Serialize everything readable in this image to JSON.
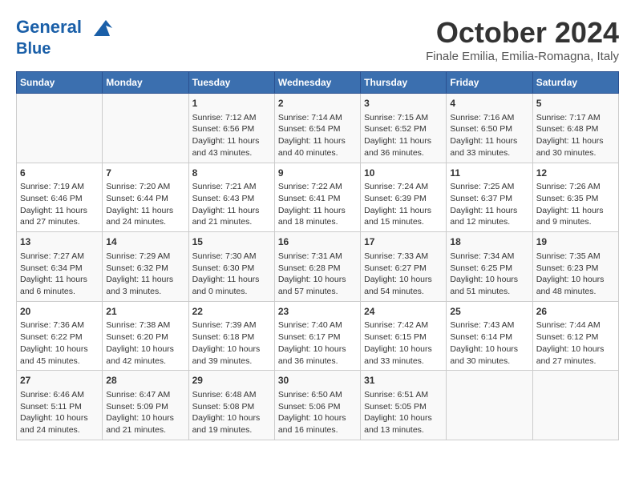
{
  "header": {
    "logo_line1": "General",
    "logo_line2": "Blue",
    "month": "October 2024",
    "location": "Finale Emilia, Emilia-Romagna, Italy"
  },
  "weekdays": [
    "Sunday",
    "Monday",
    "Tuesday",
    "Wednesday",
    "Thursday",
    "Friday",
    "Saturday"
  ],
  "weeks": [
    [
      {
        "day": "",
        "data": ""
      },
      {
        "day": "",
        "data": ""
      },
      {
        "day": "1",
        "data": "Sunrise: 7:12 AM\nSunset: 6:56 PM\nDaylight: 11 hours and 43 minutes."
      },
      {
        "day": "2",
        "data": "Sunrise: 7:14 AM\nSunset: 6:54 PM\nDaylight: 11 hours and 40 minutes."
      },
      {
        "day": "3",
        "data": "Sunrise: 7:15 AM\nSunset: 6:52 PM\nDaylight: 11 hours and 36 minutes."
      },
      {
        "day": "4",
        "data": "Sunrise: 7:16 AM\nSunset: 6:50 PM\nDaylight: 11 hours and 33 minutes."
      },
      {
        "day": "5",
        "data": "Sunrise: 7:17 AM\nSunset: 6:48 PM\nDaylight: 11 hours and 30 minutes."
      }
    ],
    [
      {
        "day": "6",
        "data": "Sunrise: 7:19 AM\nSunset: 6:46 PM\nDaylight: 11 hours and 27 minutes."
      },
      {
        "day": "7",
        "data": "Sunrise: 7:20 AM\nSunset: 6:44 PM\nDaylight: 11 hours and 24 minutes."
      },
      {
        "day": "8",
        "data": "Sunrise: 7:21 AM\nSunset: 6:43 PM\nDaylight: 11 hours and 21 minutes."
      },
      {
        "day": "9",
        "data": "Sunrise: 7:22 AM\nSunset: 6:41 PM\nDaylight: 11 hours and 18 minutes."
      },
      {
        "day": "10",
        "data": "Sunrise: 7:24 AM\nSunset: 6:39 PM\nDaylight: 11 hours and 15 minutes."
      },
      {
        "day": "11",
        "data": "Sunrise: 7:25 AM\nSunset: 6:37 PM\nDaylight: 11 hours and 12 minutes."
      },
      {
        "day": "12",
        "data": "Sunrise: 7:26 AM\nSunset: 6:35 PM\nDaylight: 11 hours and 9 minutes."
      }
    ],
    [
      {
        "day": "13",
        "data": "Sunrise: 7:27 AM\nSunset: 6:34 PM\nDaylight: 11 hours and 6 minutes."
      },
      {
        "day": "14",
        "data": "Sunrise: 7:29 AM\nSunset: 6:32 PM\nDaylight: 11 hours and 3 minutes."
      },
      {
        "day": "15",
        "data": "Sunrise: 7:30 AM\nSunset: 6:30 PM\nDaylight: 11 hours and 0 minutes."
      },
      {
        "day": "16",
        "data": "Sunrise: 7:31 AM\nSunset: 6:28 PM\nDaylight: 10 hours and 57 minutes."
      },
      {
        "day": "17",
        "data": "Sunrise: 7:33 AM\nSunset: 6:27 PM\nDaylight: 10 hours and 54 minutes."
      },
      {
        "day": "18",
        "data": "Sunrise: 7:34 AM\nSunset: 6:25 PM\nDaylight: 10 hours and 51 minutes."
      },
      {
        "day": "19",
        "data": "Sunrise: 7:35 AM\nSunset: 6:23 PM\nDaylight: 10 hours and 48 minutes."
      }
    ],
    [
      {
        "day": "20",
        "data": "Sunrise: 7:36 AM\nSunset: 6:22 PM\nDaylight: 10 hours and 45 minutes."
      },
      {
        "day": "21",
        "data": "Sunrise: 7:38 AM\nSunset: 6:20 PM\nDaylight: 10 hours and 42 minutes."
      },
      {
        "day": "22",
        "data": "Sunrise: 7:39 AM\nSunset: 6:18 PM\nDaylight: 10 hours and 39 minutes."
      },
      {
        "day": "23",
        "data": "Sunrise: 7:40 AM\nSunset: 6:17 PM\nDaylight: 10 hours and 36 minutes."
      },
      {
        "day": "24",
        "data": "Sunrise: 7:42 AM\nSunset: 6:15 PM\nDaylight: 10 hours and 33 minutes."
      },
      {
        "day": "25",
        "data": "Sunrise: 7:43 AM\nSunset: 6:14 PM\nDaylight: 10 hours and 30 minutes."
      },
      {
        "day": "26",
        "data": "Sunrise: 7:44 AM\nSunset: 6:12 PM\nDaylight: 10 hours and 27 minutes."
      }
    ],
    [
      {
        "day": "27",
        "data": "Sunrise: 6:46 AM\nSunset: 5:11 PM\nDaylight: 10 hours and 24 minutes."
      },
      {
        "day": "28",
        "data": "Sunrise: 6:47 AM\nSunset: 5:09 PM\nDaylight: 10 hours and 21 minutes."
      },
      {
        "day": "29",
        "data": "Sunrise: 6:48 AM\nSunset: 5:08 PM\nDaylight: 10 hours and 19 minutes."
      },
      {
        "day": "30",
        "data": "Sunrise: 6:50 AM\nSunset: 5:06 PM\nDaylight: 10 hours and 16 minutes."
      },
      {
        "day": "31",
        "data": "Sunrise: 6:51 AM\nSunset: 5:05 PM\nDaylight: 10 hours and 13 minutes."
      },
      {
        "day": "",
        "data": ""
      },
      {
        "day": "",
        "data": ""
      }
    ]
  ]
}
